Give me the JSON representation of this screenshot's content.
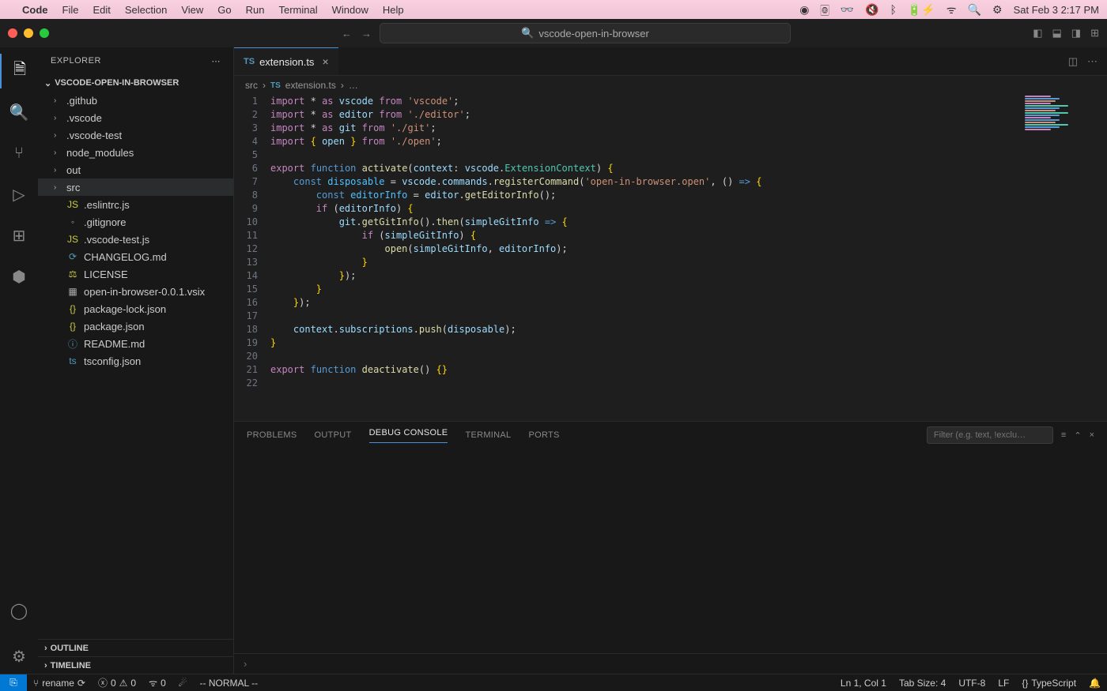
{
  "menubar": {
    "app": "Code",
    "items": [
      "File",
      "Edit",
      "Selection",
      "View",
      "Go",
      "Run",
      "Terminal",
      "Window",
      "Help"
    ],
    "datetime": "Sat Feb 3  2:17 PM"
  },
  "titlebar": {
    "search": "vscode-open-in-browser"
  },
  "sidebar": {
    "title": "EXPLORER",
    "project": "VSCODE-OPEN-IN-BROWSER",
    "tree": [
      {
        "type": "folder",
        "label": ".github"
      },
      {
        "type": "folder",
        "label": ".vscode"
      },
      {
        "type": "folder",
        "label": ".vscode-test"
      },
      {
        "type": "folder",
        "label": "node_modules"
      },
      {
        "type": "folder",
        "label": "out"
      },
      {
        "type": "folder",
        "label": "src",
        "selected": true
      },
      {
        "type": "js",
        "label": ".eslintrc.js",
        "icon": "JS"
      },
      {
        "type": "txt",
        "label": ".gitignore",
        "icon": "◦"
      },
      {
        "type": "js",
        "label": ".vscode-test.js",
        "icon": "JS"
      },
      {
        "type": "md",
        "label": "CHANGELOG.md",
        "icon": "⟳"
      },
      {
        "type": "lic",
        "label": "LICENSE",
        "icon": "⚖"
      },
      {
        "type": "txt",
        "label": "open-in-browser-0.0.1.vsix",
        "icon": "▦"
      },
      {
        "type": "json",
        "label": "package-lock.json",
        "icon": "{}"
      },
      {
        "type": "json",
        "label": "package.json",
        "icon": "{}"
      },
      {
        "type": "md",
        "label": "README.md",
        "icon": "ⓘ"
      },
      {
        "type": "ts",
        "label": "tsconfig.json",
        "icon": "ts"
      }
    ],
    "outline": "OUTLINE",
    "timeline": "TIMELINE"
  },
  "tab": {
    "icon": "TS",
    "label": "extension.ts"
  },
  "breadcrumbs": {
    "src": "src",
    "file": "extension.ts",
    "icon": "TS"
  },
  "panel": {
    "tabs": [
      "PROBLEMS",
      "OUTPUT",
      "DEBUG CONSOLE",
      "TERMINAL",
      "PORTS"
    ],
    "activeTab": "DEBUG CONSOLE",
    "filterPlaceholder": "Filter (e.g. text, !exclu…"
  },
  "statusbar": {
    "branch": "rename",
    "errors": "0",
    "warnings": "0",
    "ports": "0",
    "mode": "-- NORMAL --",
    "position": "Ln 1, Col 1",
    "tabsize": "Tab Size: 4",
    "encoding": "UTF-8",
    "eol": "LF",
    "language": "TypeScript"
  },
  "code": {
    "lineCount": 22
  }
}
